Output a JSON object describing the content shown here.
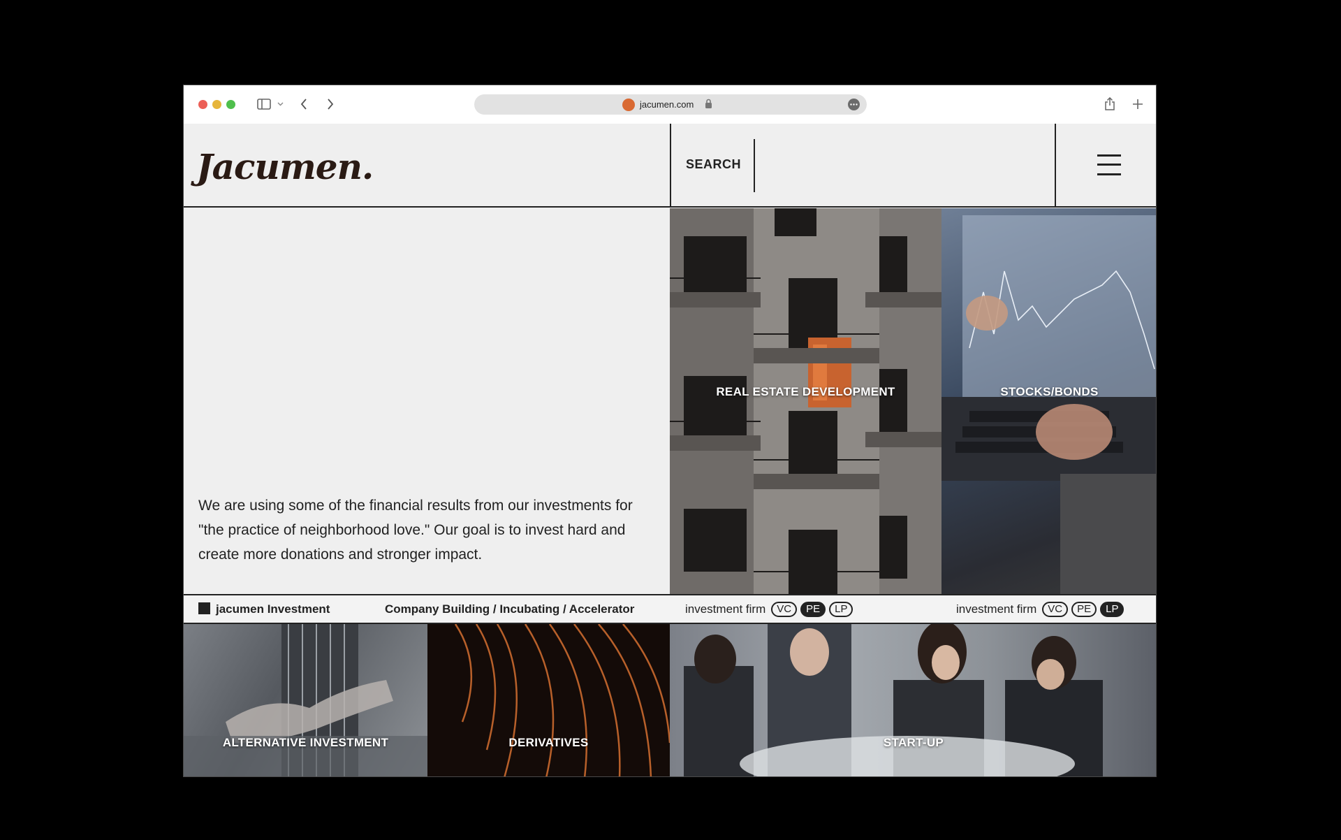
{
  "browser": {
    "url": "jacumen.com"
  },
  "header": {
    "logo": "Jacumen.",
    "search_label": "SEARCH"
  },
  "intro": {
    "text": "We are using some of the financial results from our investments for \"the practice of neighborhood love.\" Our goal is to invest hard and create more donations and stronger impact."
  },
  "tiles": {
    "real_estate": "REAL ESTATE DEVELOPMENT",
    "stocks": "STOCKS/BONDS",
    "alternative": "ALTERNATIVE INVESTMENT",
    "derivatives": "DERIVATIVES",
    "startup": "START-UP"
  },
  "infobar": {
    "brand": "jacumen Investment",
    "services": "Company Building / Incubating / Accelerator",
    "firm_groups": [
      {
        "label": "investment firm",
        "pills": [
          "VC",
          "PE",
          "LP"
        ],
        "active": "PE"
      },
      {
        "label": "investment firm",
        "pills": [
          "VC",
          "PE",
          "LP"
        ],
        "active": "LP"
      }
    ]
  },
  "colors": {
    "accent": "#d96a33",
    "ink": "#222222",
    "page_bg": "#efefef"
  }
}
